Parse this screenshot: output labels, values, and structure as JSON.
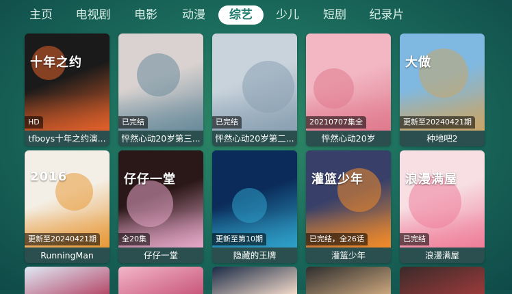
{
  "nav": {
    "tabs": [
      {
        "label": "主页"
      },
      {
        "label": "电视剧"
      },
      {
        "label": "电影"
      },
      {
        "label": "动漫"
      },
      {
        "label": "综艺",
        "active": true
      },
      {
        "label": "少儿"
      },
      {
        "label": "短剧"
      },
      {
        "label": "纪录片"
      }
    ]
  },
  "cards": [
    {
      "title": "tfboys十年之约演...",
      "badge": "HD",
      "colors": [
        "#1a1a1a",
        "#e0602a"
      ],
      "poster_text": "十年之约"
    },
    {
      "title": "怦然心动20岁第三...",
      "badge": "已完结",
      "colors": [
        "#d9d2d0",
        "#6b8c9c"
      ],
      "poster_text": ""
    },
    {
      "title": "怦然心动20岁第二...",
      "badge": "已完结",
      "colors": [
        "#c9d3dc",
        "#8aa1b3"
      ],
      "poster_text": ""
    },
    {
      "title": "怦然心动20岁",
      "badge": "20210707集全",
      "colors": [
        "#f2b7c3",
        "#e07a8e"
      ],
      "poster_text": ""
    },
    {
      "title": "种地吧2",
      "badge": "更新至20240421期",
      "colors": [
        "#7fb9e1",
        "#c7a56a"
      ],
      "poster_text": "大做"
    },
    {
      "title": "RunningMan",
      "badge": "更新至20240421期",
      "colors": [
        "#f4efe6",
        "#e79a3b"
      ],
      "poster_text": "2016"
    },
    {
      "title": "仔仔一堂",
      "badge": "全20集",
      "colors": [
        "#2a1717",
        "#e5a6c7"
      ],
      "poster_text": "仔仔一堂"
    },
    {
      "title": "隐藏的王牌",
      "badge": "更新至第10期",
      "colors": [
        "#0b2c5a",
        "#2ea0c8"
      ],
      "poster_text": ""
    },
    {
      "title": "灌篮少年",
      "badge": "已完结，全26话",
      "colors": [
        "#38406a",
        "#f08a2a"
      ],
      "poster_text": "灌篮少年"
    },
    {
      "title": "浪漫满屋",
      "badge": "已完结",
      "colors": [
        "#f7dfe4",
        "#ef7f9a"
      ],
      "poster_text": "浪漫满屋"
    }
  ],
  "bottom_tiles": [
    {
      "colors": [
        "#dfe9f5",
        "#b54a6a"
      ]
    },
    {
      "colors": [
        "#f3b6c8",
        "#c8577b"
      ]
    },
    {
      "colors": [
        "#1a2b46",
        "#f2d9c9"
      ]
    },
    {
      "colors": [
        "#2e2e2e",
        "#caa57c"
      ]
    },
    {
      "colors": [
        "#3b2a2a",
        "#9a3a3a"
      ]
    }
  ]
}
